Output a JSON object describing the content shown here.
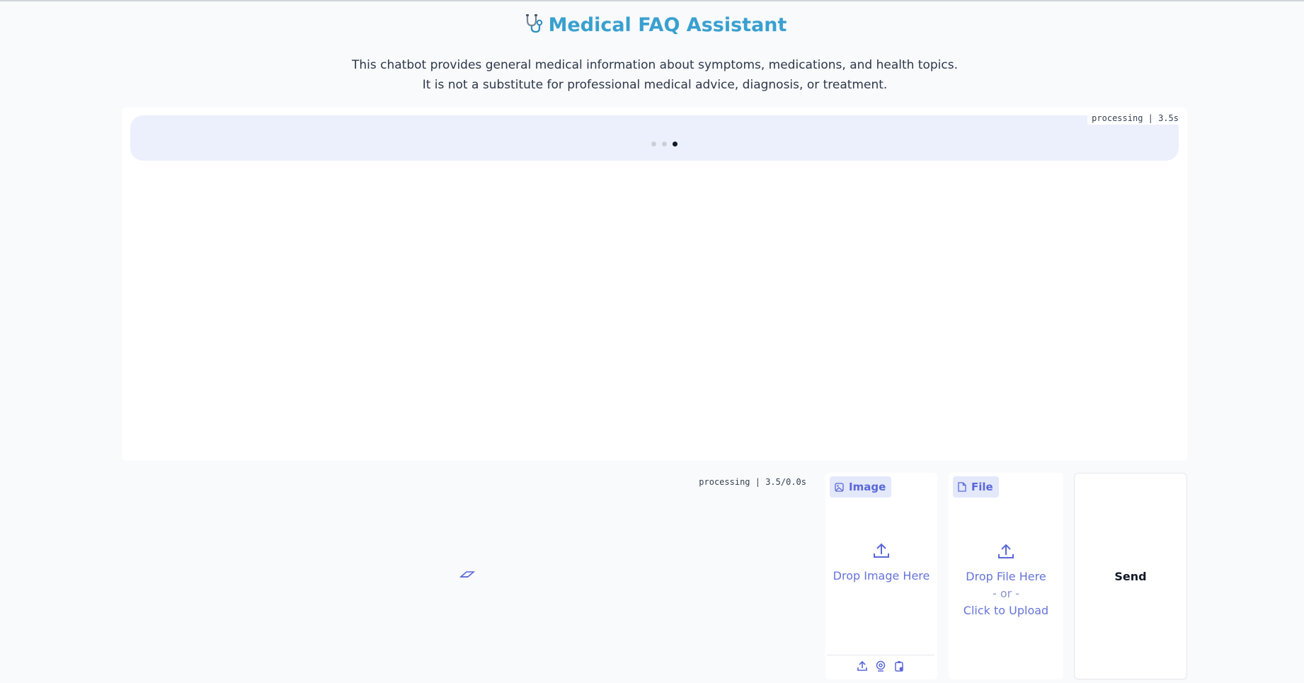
{
  "header": {
    "title": "Medical FAQ Assistant",
    "title_icon": "stethoscope-icon",
    "description_line1": "This chatbot provides general medical information about symptoms, medications, and health topics.",
    "description_line2": "It is not a substitute for professional medical advice, diagnosis, or treatment."
  },
  "chat": {
    "status": "processing | 3.5s",
    "loading_dots_active_index": 2
  },
  "input": {
    "status": "processing | 3.5/0.0s"
  },
  "image_upload": {
    "label": "Image",
    "drop_text": "Drop Image Here",
    "tools": [
      "upload-icon",
      "webcam-icon",
      "clipboard-icon"
    ]
  },
  "file_upload": {
    "label": "File",
    "drop_text": "Drop File Here",
    "or_text": "- or -",
    "click_text": "Click to Upload"
  },
  "send": {
    "label": "Send"
  },
  "colors": {
    "title": "#3aa0cf",
    "accent": "#5a67d8",
    "pending_bubble": "#ecf0fc"
  }
}
